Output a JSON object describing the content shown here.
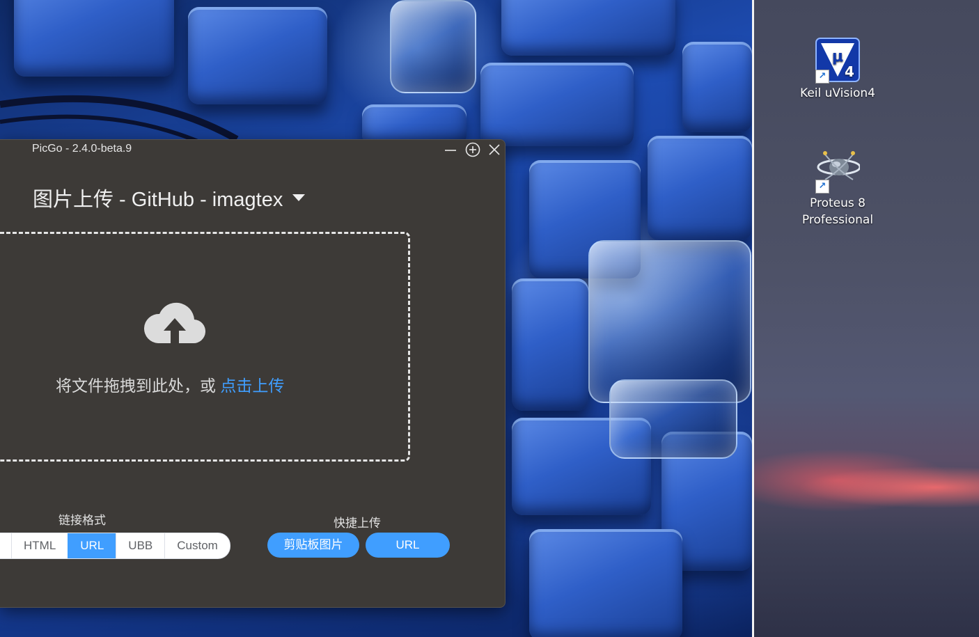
{
  "picgo": {
    "title": "PicGo - 2.4.0-beta.9",
    "heading": "图片上传 - GitHub - imagtex",
    "drop_text": "将文件拖拽到此处，或 ",
    "drop_link": "点击上传",
    "link_format_label": "链接格式",
    "link_formats": [
      "HTML",
      "URL",
      "UBB",
      "Custom"
    ],
    "selected_format": "URL",
    "quick_upload_label": "快捷上传",
    "quick_upload_buttons": [
      "剪贴板图片",
      "URL"
    ],
    "accent_color": "#409eff",
    "window_bg": "#3d3a37"
  },
  "desktop": {
    "icons": [
      {
        "label": "Keil uVision4",
        "icon": "keil-uvision-icon"
      },
      {
        "label": "Proteus 8\nProfessional",
        "icon": "proteus-icon"
      }
    ]
  }
}
